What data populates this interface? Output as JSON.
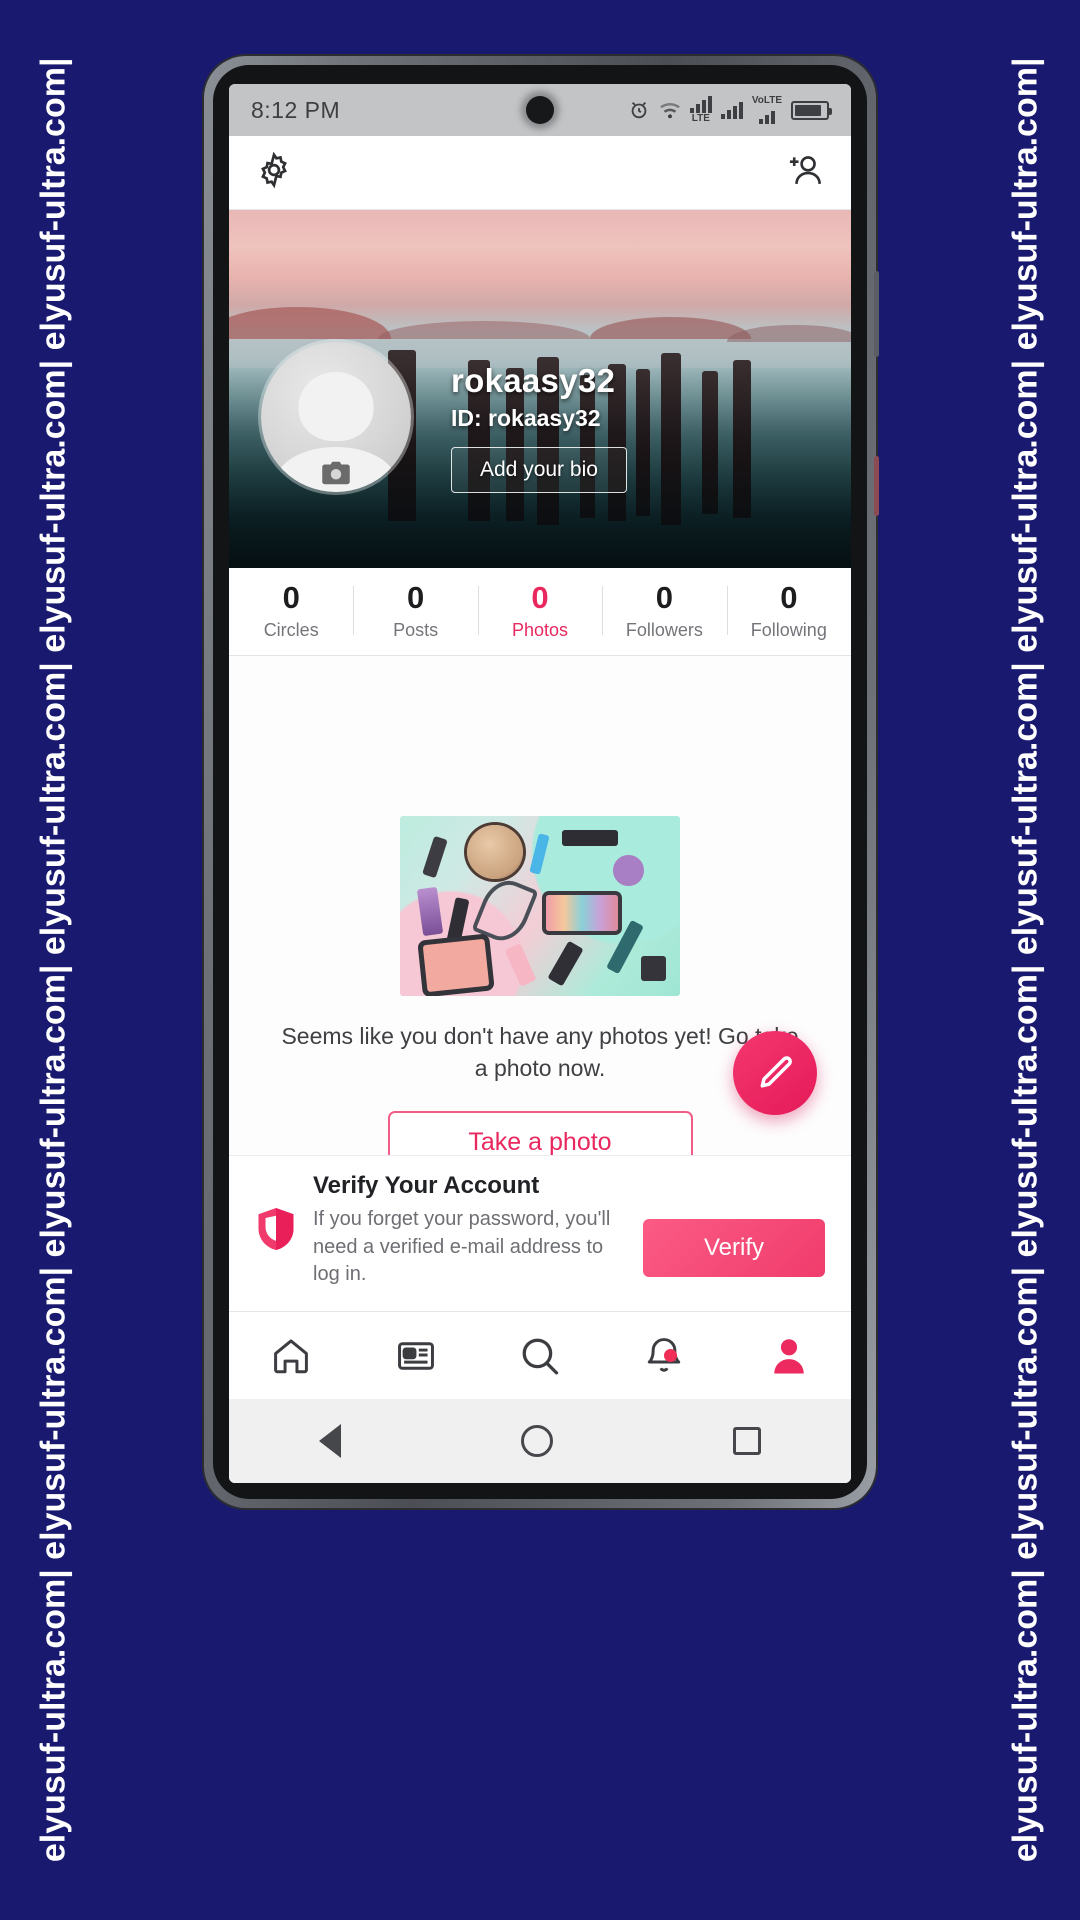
{
  "watermark": {
    "text": "elyusuf-ultra.com| elyusuf-ultra.com| elyusuf-ultra.com| elyusuf-ultra.com| elyusuf-ultra.com| elyusuf-ultra.com|"
  },
  "statusbar": {
    "time": "8:12 PM",
    "icons": [
      "alarm-icon",
      "wifi-icon",
      "lte-signal-icon",
      "signal-bars-icon",
      "volte-icon",
      "battery-icon"
    ],
    "lte_label": "LTE",
    "volte_label": "VoLTE"
  },
  "appbar": {
    "settings_icon": "gear-icon",
    "add_friend_icon": "add-person-icon"
  },
  "profile": {
    "username": "rokaasy32",
    "id_line": "ID: rokaasy32",
    "bio_button": "Add your bio",
    "avatar_camera_icon": "camera-icon"
  },
  "stats": [
    {
      "value": "0",
      "label": "Circles",
      "active": false
    },
    {
      "value": "0",
      "label": "Posts",
      "active": false
    },
    {
      "value": "0",
      "label": "Photos",
      "active": true
    },
    {
      "value": "0",
      "label": "Followers",
      "active": false
    },
    {
      "value": "0",
      "label": "Following",
      "active": false
    }
  ],
  "empty_state": {
    "message": "Seems like you don't have any photos yet! Go take a photo now.",
    "button": "Take a photo",
    "image_alt": "makeup-flatlay-image"
  },
  "fab": {
    "icon": "pencil-icon"
  },
  "verify": {
    "title": "Verify Your Account",
    "description": "If you forget your password, you'll need a verified e-mail address to log in.",
    "button": "Verify",
    "icon": "shield-icon"
  },
  "bottom_nav": [
    {
      "icon": "home-icon",
      "active": false,
      "badge": false
    },
    {
      "icon": "news-icon",
      "active": false,
      "badge": false
    },
    {
      "icon": "search-icon",
      "active": false,
      "badge": false
    },
    {
      "icon": "bell-icon",
      "active": false,
      "badge": true
    },
    {
      "icon": "profile-icon",
      "active": true,
      "badge": false
    }
  ],
  "android_nav": [
    {
      "icon": "back-icon"
    },
    {
      "icon": "home-circle-icon"
    },
    {
      "icon": "recents-square-icon"
    }
  ],
  "colors": {
    "accent_pink": "#e8285f",
    "page_bg": "#191970",
    "badge_red": "#ef2f55"
  }
}
